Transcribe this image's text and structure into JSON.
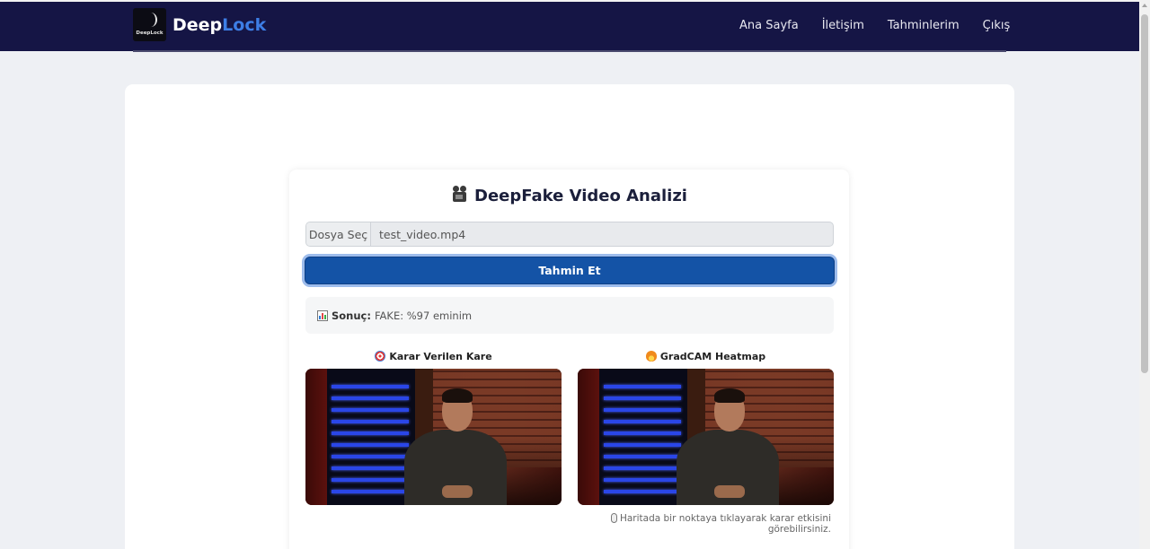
{
  "brand": {
    "logo_text": "DeepLock",
    "name_part1": "Deep",
    "name_part2": "Lock"
  },
  "nav": {
    "items": [
      {
        "label": "Ana Sayfa"
      },
      {
        "label": "İletişim"
      },
      {
        "label": "Tahminlerim"
      },
      {
        "label": "Çıkış"
      }
    ]
  },
  "page": {
    "title": "DeepFake Video Analizi",
    "title_icon": "movie-camera-icon"
  },
  "upload": {
    "button_label": "Dosya Seç",
    "file_name": "test_video.mp4"
  },
  "predict": {
    "label": "Tahmin Et"
  },
  "result": {
    "icon": "bar-chart-icon",
    "label": "Sonuç:",
    "value": "FAKE: %97 eminim"
  },
  "images": [
    {
      "title": "Karar Verilen Kare",
      "icon": "target-icon",
      "icon_color": "#e03c3c"
    },
    {
      "title": "GradCAM Heatmap",
      "icon": "fire-icon",
      "icon_color": "#f08a1c"
    }
  ],
  "hint": {
    "icon": "mouse-icon",
    "text": "Haritada bir noktaya tıklayarak karar etkisini görebilirsiniz."
  },
  "colors": {
    "navbar": "#151545",
    "brand_accent": "#3d7ee6",
    "primary_button": "#1453a6"
  }
}
